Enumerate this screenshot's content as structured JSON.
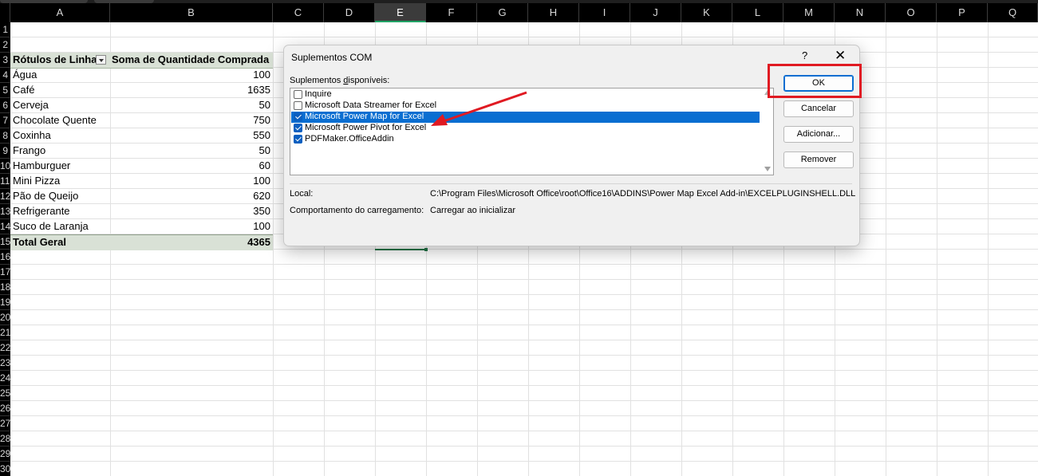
{
  "spreadsheet": {
    "columns": [
      "A",
      "B",
      "C",
      "D",
      "E",
      "F",
      "G",
      "H",
      "I",
      "J",
      "K",
      "L",
      "M",
      "N",
      "O",
      "P",
      "Q"
    ],
    "selected_column": "E",
    "row_numbers": [
      "1",
      "2",
      "3",
      "4",
      "5",
      "6",
      "7",
      "8",
      "9",
      "10",
      "11",
      "12",
      "13",
      "14",
      "15",
      "16",
      "17",
      "18",
      "19",
      "20",
      "21",
      "22",
      "23",
      "24",
      "25",
      "26",
      "27",
      "28",
      "29",
      "30"
    ],
    "pivot": {
      "header_label": "Rótulos de Linha",
      "header_value": "Soma de Quantidade Comprada",
      "rows": [
        {
          "label": "Água",
          "value": "100"
        },
        {
          "label": "Café",
          "value": "1635"
        },
        {
          "label": "Cerveja",
          "value": "50"
        },
        {
          "label": "Chocolate Quente",
          "value": "750"
        },
        {
          "label": "Coxinha",
          "value": "550"
        },
        {
          "label": "Frango",
          "value": "50"
        },
        {
          "label": "Hamburguer",
          "value": "60"
        },
        {
          "label": "Mini Pizza",
          "value": "100"
        },
        {
          "label": "Pão de Queijo",
          "value": "620"
        },
        {
          "label": "Refrigerante",
          "value": "350"
        },
        {
          "label": "Suco de Laranja",
          "value": "100"
        }
      ],
      "total_label": "Total Geral",
      "total_value": "4365"
    }
  },
  "dialog": {
    "title": "Suplementos COM",
    "help_label": "?",
    "close_label": "✕",
    "available_prefix": "Suplementos ",
    "available_underlined": "d",
    "available_suffix": "isponíveis:",
    "addins": [
      {
        "label": "Inquire",
        "checked": false,
        "selected": false
      },
      {
        "label": "Microsoft Data Streamer for Excel",
        "checked": false,
        "selected": false
      },
      {
        "label": "Microsoft Power Map for Excel",
        "checked": true,
        "selected": true
      },
      {
        "label": "Microsoft Power Pivot for Excel",
        "checked": true,
        "selected": false
      },
      {
        "label": "PDFMaker.OfficeAddin",
        "checked": true,
        "selected": false
      }
    ],
    "location_label": "Local:",
    "location_value": "C:\\Program Files\\Microsoft Office\\root\\Office16\\ADDINS\\Power Map Excel Add-in\\EXCELPLUGINSHELL.DLL",
    "behavior_label": "Comportamento do carregamento:",
    "behavior_value": "Carregar ao inicializar",
    "buttons": {
      "ok": "OK",
      "cancel": "Cancelar",
      "add": "Adicionar...",
      "remove": "Remover"
    }
  },
  "annotation": {
    "highlight_color": "#e01a22",
    "arrow_color": "#e01a22"
  }
}
